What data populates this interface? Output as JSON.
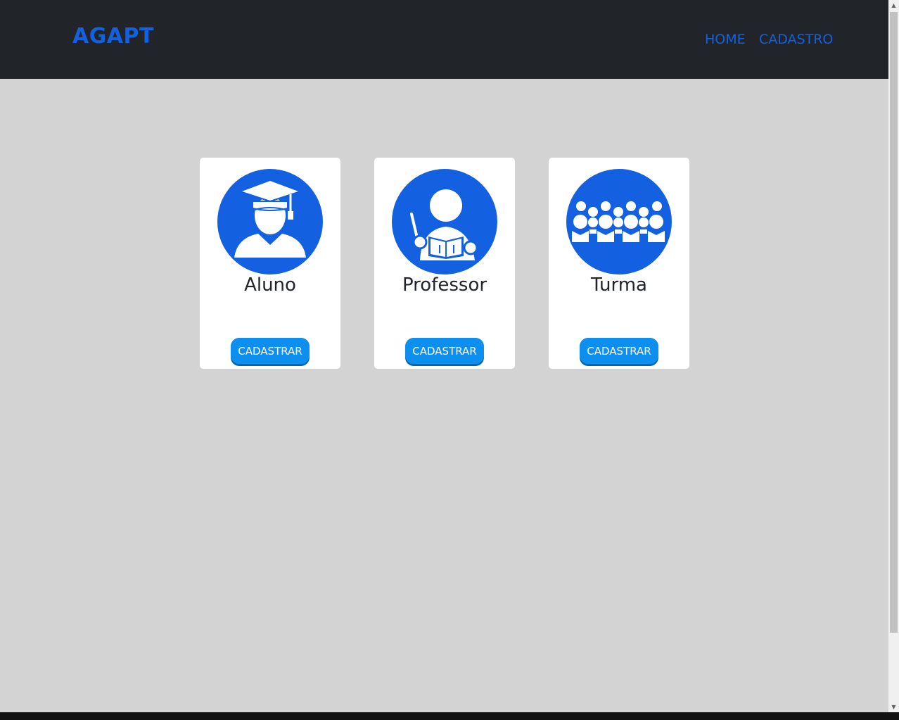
{
  "navbar": {
    "brand": "AGAPT",
    "links": [
      {
        "label": "HOME"
      },
      {
        "label": "CADASTRO"
      }
    ]
  },
  "cards": [
    {
      "title": "Aluno",
      "icon": "graduate-student-icon",
      "button": "CADASTRAR"
    },
    {
      "title": "Professor",
      "icon": "teacher-reading-icon",
      "button": "CADASTRAR"
    },
    {
      "title": "Turma",
      "icon": "class-group-icon",
      "button": "CADASTRAR"
    }
  ],
  "colors": {
    "navbar_bg": "#212529",
    "accent": "#1361e0",
    "button": "#0d8ff0",
    "page_bg": "#d3d3d3"
  }
}
